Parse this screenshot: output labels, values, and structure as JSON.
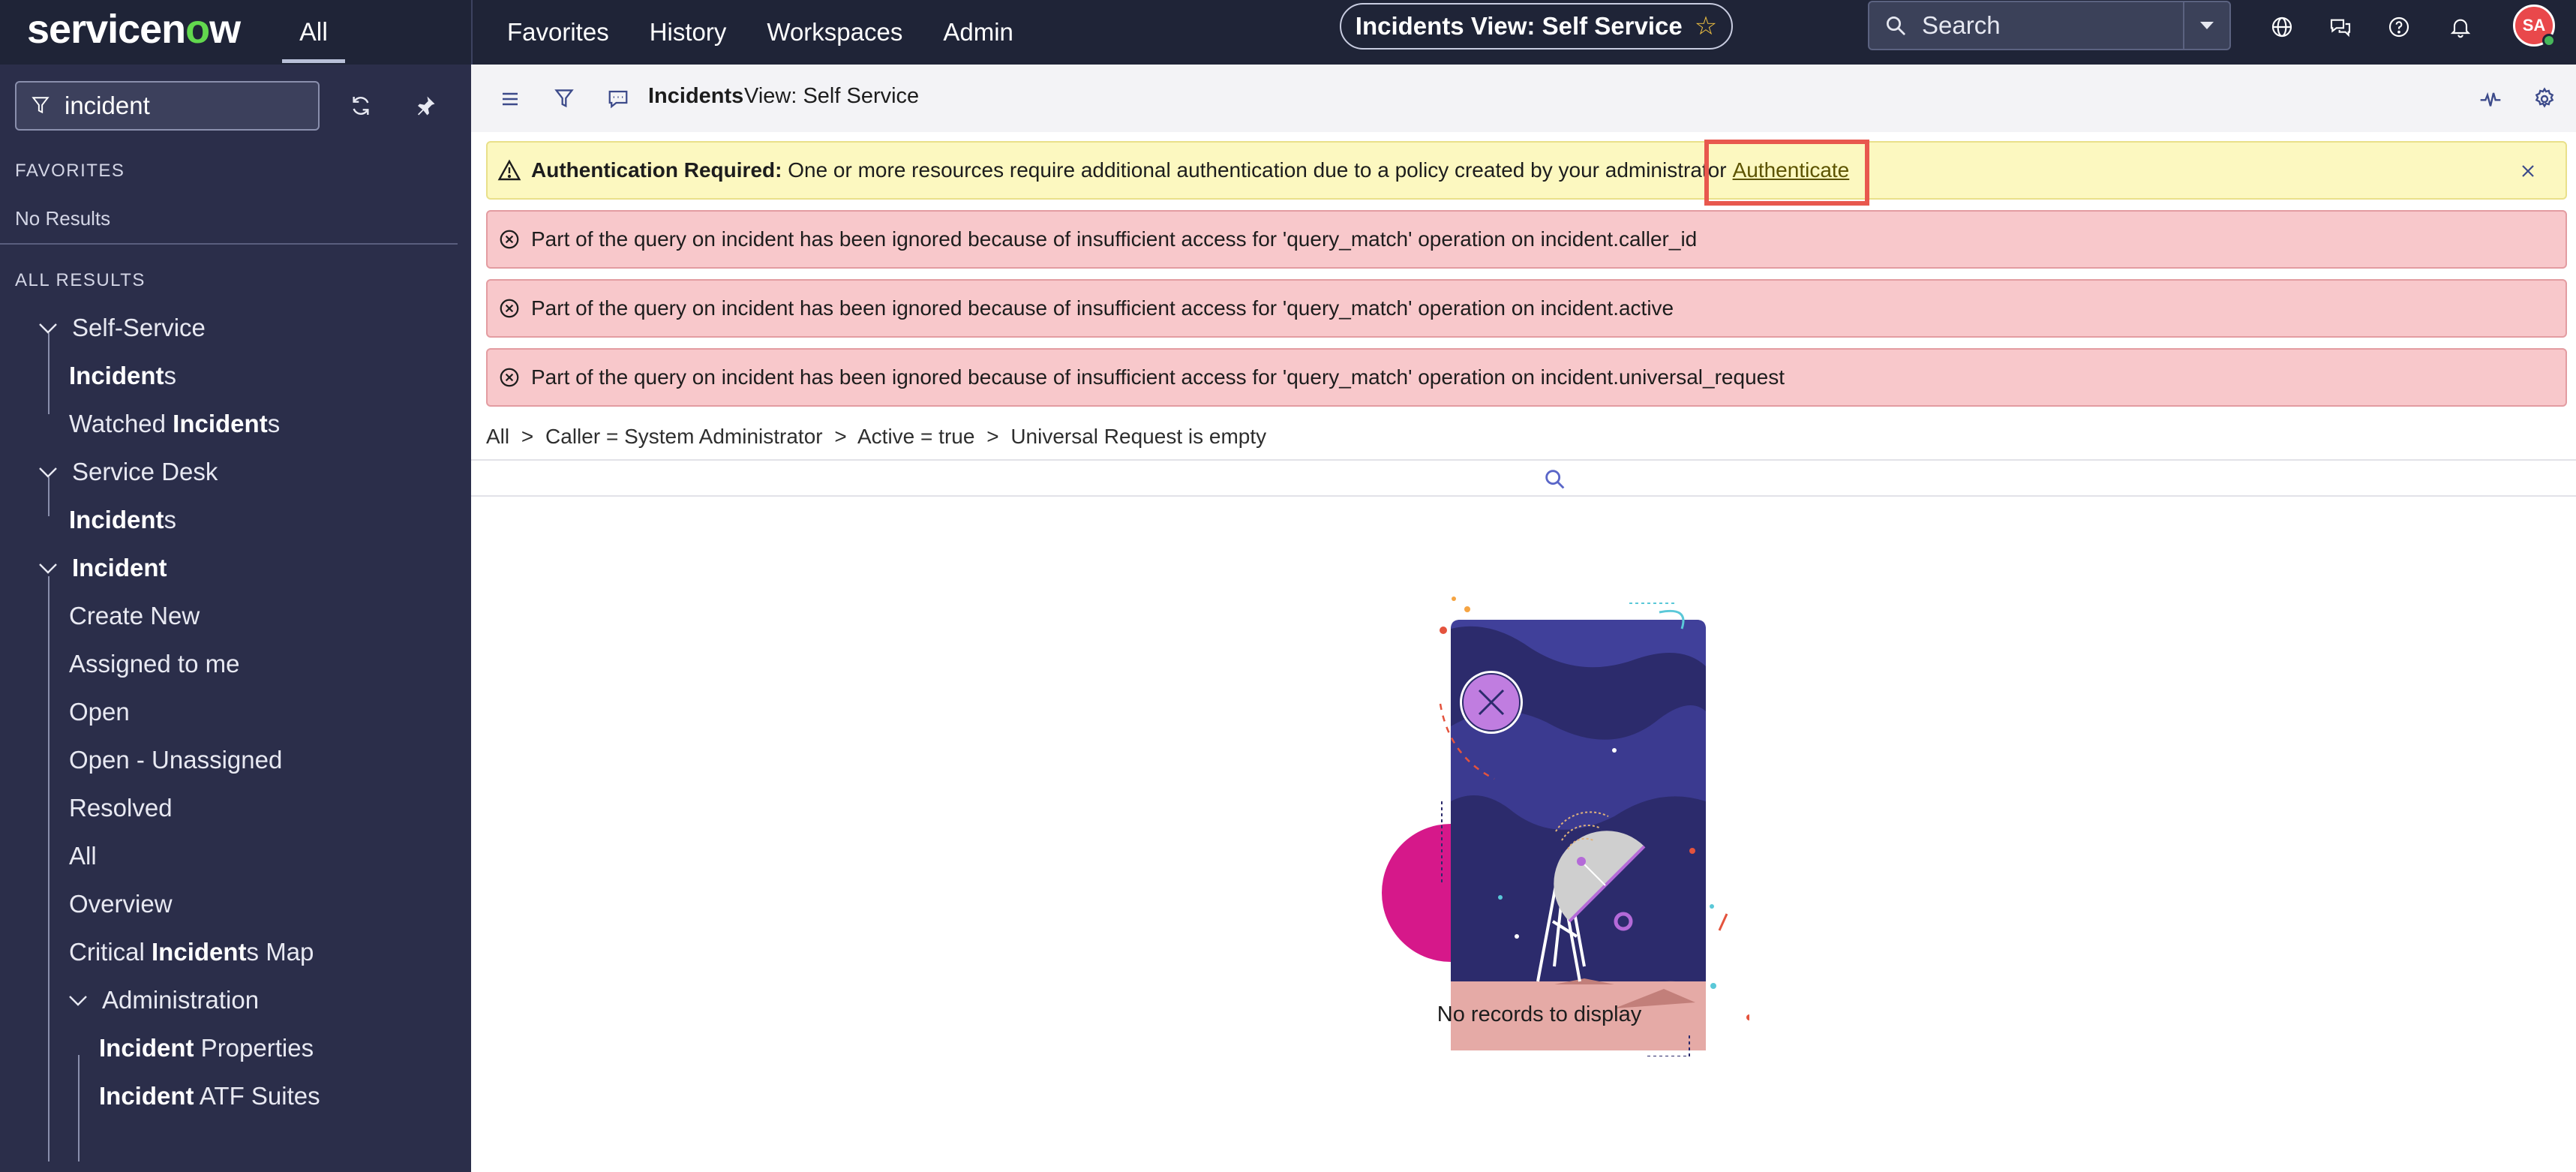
{
  "header": {
    "logo": "servicenow",
    "all_tab": "All",
    "nav": [
      "Favorites",
      "History",
      "Workspaces",
      "Admin"
    ],
    "page_title": "Incidents View: Self Service",
    "search_placeholder": "Search",
    "icons": [
      "globe-icon",
      "chat-icon",
      "help-icon",
      "bell-icon"
    ],
    "avatar_initials": "SA"
  },
  "sidebar": {
    "filter_value": "incident",
    "favorites_label": "FAVORITES",
    "favorites_empty": "No Results",
    "all_results_label": "ALL RESULTS",
    "groups": [
      {
        "label": "Self-Service",
        "items": [
          {
            "bold": "Incident",
            "rest": "s",
            "prefix": ""
          },
          {
            "prefix": "Watched ",
            "bold": "Incident",
            "rest": "s"
          }
        ]
      },
      {
        "label": "Service Desk",
        "items": [
          {
            "prefix": "",
            "bold": "Incident",
            "rest": "s"
          }
        ]
      },
      {
        "label": "Incident",
        "items": [
          "Create New",
          "Assigned to me",
          "Open",
          "Open - Unassigned",
          "Resolved",
          "All",
          "Overview"
        ],
        "critical": {
          "prefix": "Critical ",
          "bold": "Incident",
          "rest": "s Map"
        },
        "subgroup": {
          "label": "Administration",
          "items": [
            {
              "bold": "Incident",
              "rest": " Properties"
            },
            {
              "bold": "Incident",
              "rest": " ATF Suites"
            }
          ]
        }
      }
    ]
  },
  "toolbar": {
    "title": "Incidents",
    "view": "View: Self Service"
  },
  "alerts": {
    "auth": {
      "bold": "Authentication Required:",
      "text": " One or more resources require additional authentication due to a policy created by your administrator",
      "link": "Authenticate"
    },
    "errors": [
      "Part of the query on incident has been ignored because of insufficient access for 'query_match' operation on incident.caller_id",
      "Part of the query on incident has been ignored because of insufficient access for 'query_match' operation on incident.active",
      "Part of the query on incident has been ignored because of insufficient access for 'query_match' operation on incident.universal_request"
    ]
  },
  "breadcrumb": [
    "All",
    ">",
    "Caller = System Administrator",
    ">",
    "Active = true",
    ">",
    "Universal Request is empty"
  ],
  "empty_state": "No records to display",
  "colors": {
    "topbar": "#1f2437",
    "sidebar": "#2b2e4a",
    "warn_bg": "#fcf8c0",
    "error_bg": "#f8c8cb",
    "highlight": "#e8584e"
  }
}
